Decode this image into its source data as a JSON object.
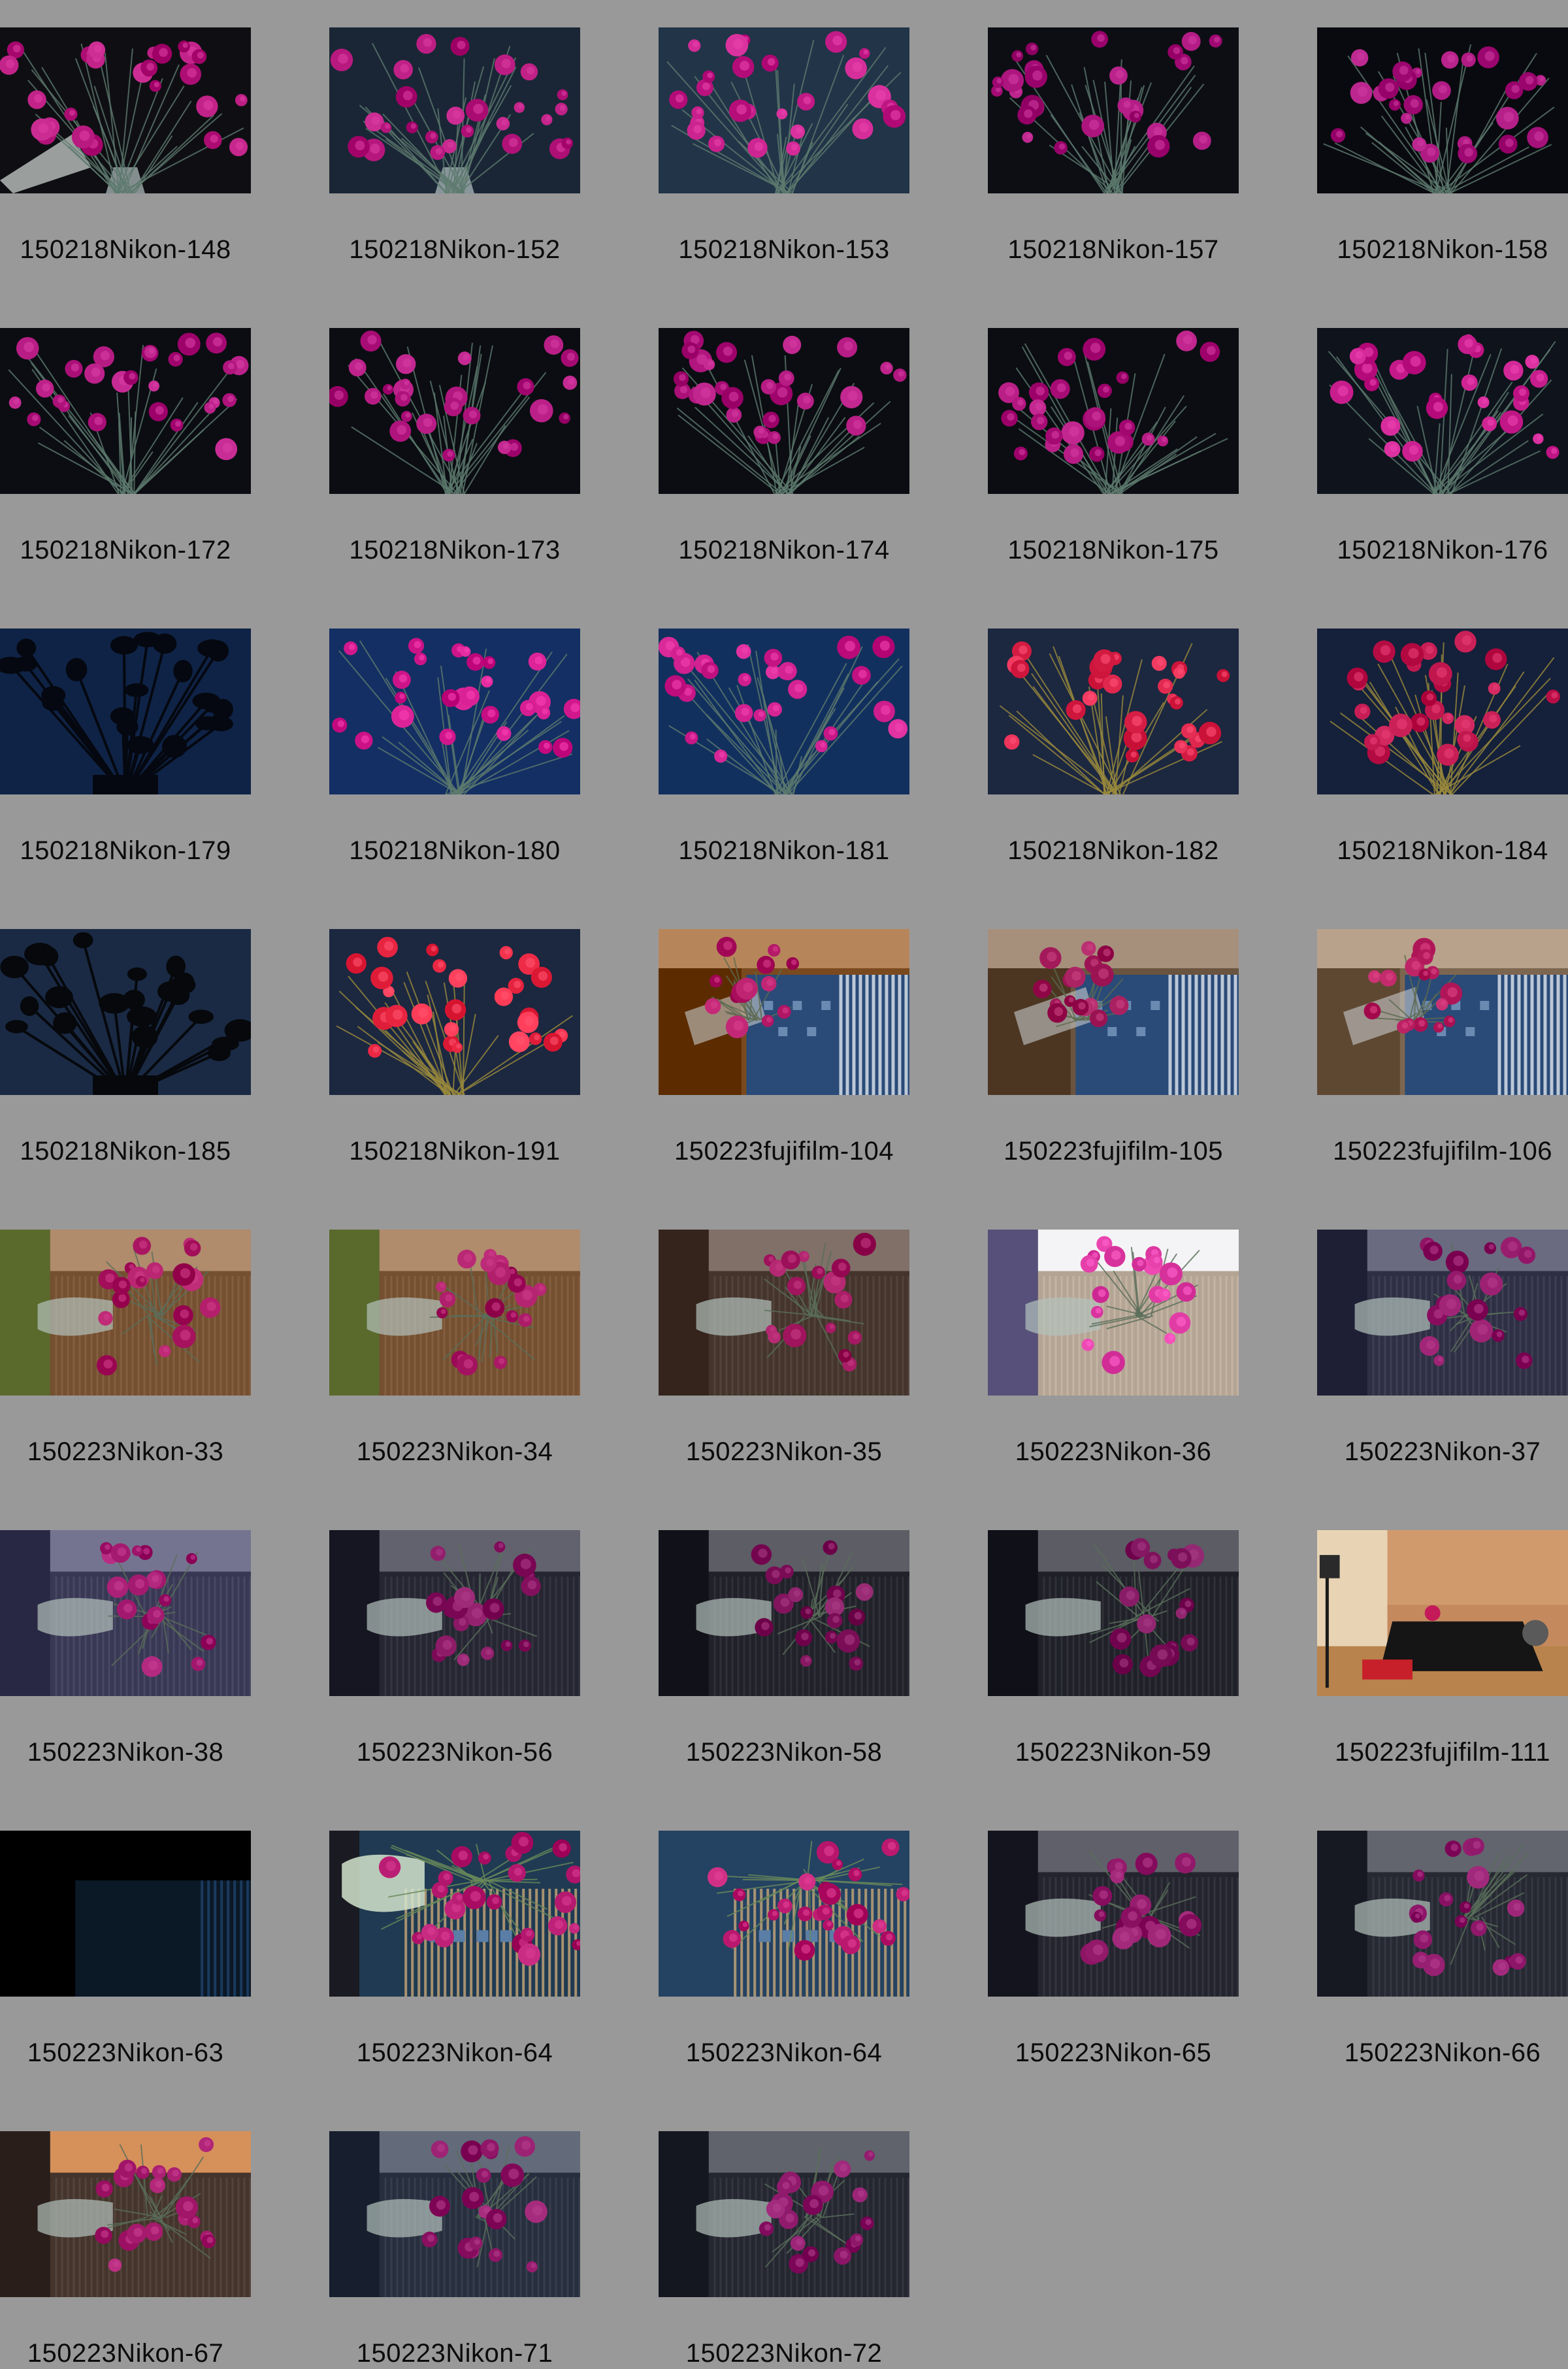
{
  "sheet": {
    "background": "#999999",
    "columns": 5,
    "items": [
      {
        "label": "150218Nikon-148",
        "scene": "studio-bouquet",
        "bg": "#0f0f13",
        "flower": "#b5167c",
        "extra": "vase-tilted"
      },
      {
        "label": "150218Nikon-152",
        "scene": "studio-bouquet",
        "bg": "#1a2636",
        "flower": "#b3147a",
        "extra": "vase"
      },
      {
        "label": "150218Nikon-153",
        "scene": "studio-bouquet",
        "bg": "#213448",
        "flower": "#c21a86",
        "extra": "none"
      },
      {
        "label": "150218Nikon-157",
        "scene": "studio-bouquet",
        "bg": "#0c0e14",
        "flower": "#a8127a",
        "extra": "none"
      },
      {
        "label": "150218Nikon-158",
        "scene": "studio-bouquet",
        "bg": "#090a0f",
        "flower": "#a6117a",
        "extra": "none"
      },
      {
        "label": "150218Nikon-172",
        "scene": "studio-bouquet",
        "bg": "#0b0d12",
        "flower": "#b0157e",
        "extra": "none"
      },
      {
        "label": "150218Nikon-173",
        "scene": "studio-bouquet",
        "bg": "#0b0d12",
        "flower": "#ae137c",
        "extra": "none"
      },
      {
        "label": "150218Nikon-174",
        "scene": "studio-bouquet",
        "bg": "#0b0d12",
        "flower": "#ad137b",
        "extra": "none"
      },
      {
        "label": "150218Nikon-175",
        "scene": "studio-bouquet",
        "bg": "#0b0d12",
        "flower": "#ad127b",
        "extra": "none"
      },
      {
        "label": "150218Nikon-176",
        "scene": "studio-bouquet",
        "bg": "#0e131c",
        "flower": "#c51a8a",
        "extra": "none"
      },
      {
        "label": "150218Nikon-179",
        "scene": "silhouette",
        "bg": "#0f2346",
        "flower": "#050810",
        "extra": "none"
      },
      {
        "label": "150218Nikon-180",
        "scene": "studio-bouquet",
        "bg": "#132f63",
        "flower": "#d0188c",
        "extra": "none"
      },
      {
        "label": "150218Nikon-181",
        "scene": "studio-bouquet",
        "bg": "#12305e",
        "flower": "#cb1a8a",
        "extra": "none"
      },
      {
        "label": "150218Nikon-182",
        "scene": "studio-bouquet",
        "bg": "#1c2740",
        "flower": "#e0284e",
        "extra": "warm"
      },
      {
        "label": "150218Nikon-184",
        "scene": "studio-bouquet",
        "bg": "#15203a",
        "flower": "#c0164e",
        "extra": "warm"
      },
      {
        "label": "150218Nikon-185",
        "scene": "silhouette",
        "bg": "#1a2a44",
        "flower": "#06080c",
        "extra": "none"
      },
      {
        "label": "150218Nikon-191",
        "scene": "studio-bouquet",
        "bg": "#1c2740",
        "flower": "#ee2c48",
        "extra": "warm"
      },
      {
        "label": "150223fujifilm-104",
        "scene": "window-room",
        "bg": "#7a4a1e",
        "flower": "#b01664",
        "extra": "blinds"
      },
      {
        "label": "150223fujifilm-105",
        "scene": "window-room",
        "bg": "#6a5440",
        "flower": "#a31a5a",
        "extra": "blinds"
      },
      {
        "label": "150223fujifilm-106",
        "scene": "window-room",
        "bg": "#7d6650",
        "flower": "#b51c5e",
        "extra": "blinds"
      },
      {
        "label": "150223Nikon-33",
        "scene": "vase-blinds",
        "bg": "#6a4526",
        "flower": "#a81460",
        "extra": "plant"
      },
      {
        "label": "150223Nikon-34",
        "scene": "vase-blinds",
        "bg": "#6a4526",
        "flower": "#a51460",
        "extra": "plant"
      },
      {
        "label": "150223Nikon-35",
        "scene": "vase-blinds",
        "bg": "#3a2a22",
        "flower": "#9e135c",
        "extra": "dark"
      },
      {
        "label": "150223Nikon-36",
        "scene": "vase-blinds",
        "bg": "#5a4f6e",
        "flower": "#e13ca6",
        "extra": "bright"
      },
      {
        "label": "150223Nikon-37",
        "scene": "vase-blinds",
        "bg": "#24253a",
        "flower": "#8e1264",
        "extra": "curtain"
      },
      {
        "label": "150223Nikon-38",
        "scene": "vase-blinds",
        "bg": "#2f2e4a",
        "flower": "#a0166c",
        "extra": "curtain"
      },
      {
        "label": "150223Nikon-56",
        "scene": "vase-blinds",
        "bg": "#1c1c28",
        "flower": "#861360",
        "extra": "curtain"
      },
      {
        "label": "150223Nikon-58",
        "scene": "vase-blinds",
        "bg": "#17171f",
        "flower": "#80125c",
        "extra": "curtain"
      },
      {
        "label": "150223Nikon-59",
        "scene": "vase-blinds",
        "bg": "#15161e",
        "flower": "#7f125c",
        "extra": "curtain"
      },
      {
        "label": "150223fujifilm-111",
        "scene": "living-room",
        "bg": "#c48a5e",
        "flower": "#c41a5a",
        "extra": "table"
      },
      {
        "label": "150223Nikon-63",
        "scene": "near-black",
        "bg": "#000000",
        "flower": "#0b1826",
        "extra": "none"
      },
      {
        "label": "150223Nikon-64",
        "scene": "window-flowers",
        "bg": "#1f3a52",
        "flower": "#b0146a",
        "extra": "vase-bright"
      },
      {
        "label": "150223Nikon-64",
        "scene": "window-flowers",
        "bg": "#244262",
        "flower": "#ba186e",
        "extra": "none"
      },
      {
        "label": "150223Nikon-65",
        "scene": "vase-blinds",
        "bg": "#1a1a24",
        "flower": "#8e1466",
        "extra": "curtain"
      },
      {
        "label": "150223Nikon-66",
        "scene": "vase-blinds",
        "bg": "#1c1e28",
        "flower": "#8c1466",
        "extra": "curtain"
      },
      {
        "label": "150223Nikon-67",
        "scene": "vase-blinds",
        "bg": "#3a2a22",
        "flower": "#a3186a",
        "extra": "warm-wall"
      },
      {
        "label": "150223Nikon-71",
        "scene": "vase-blinds",
        "bg": "#1d2434",
        "flower": "#8e1466",
        "extra": "curtain"
      },
      {
        "label": "150223Nikon-72",
        "scene": "vase-blinds",
        "bg": "#1a1c26",
        "flower": "#8a1466",
        "extra": "curtain"
      }
    ]
  }
}
